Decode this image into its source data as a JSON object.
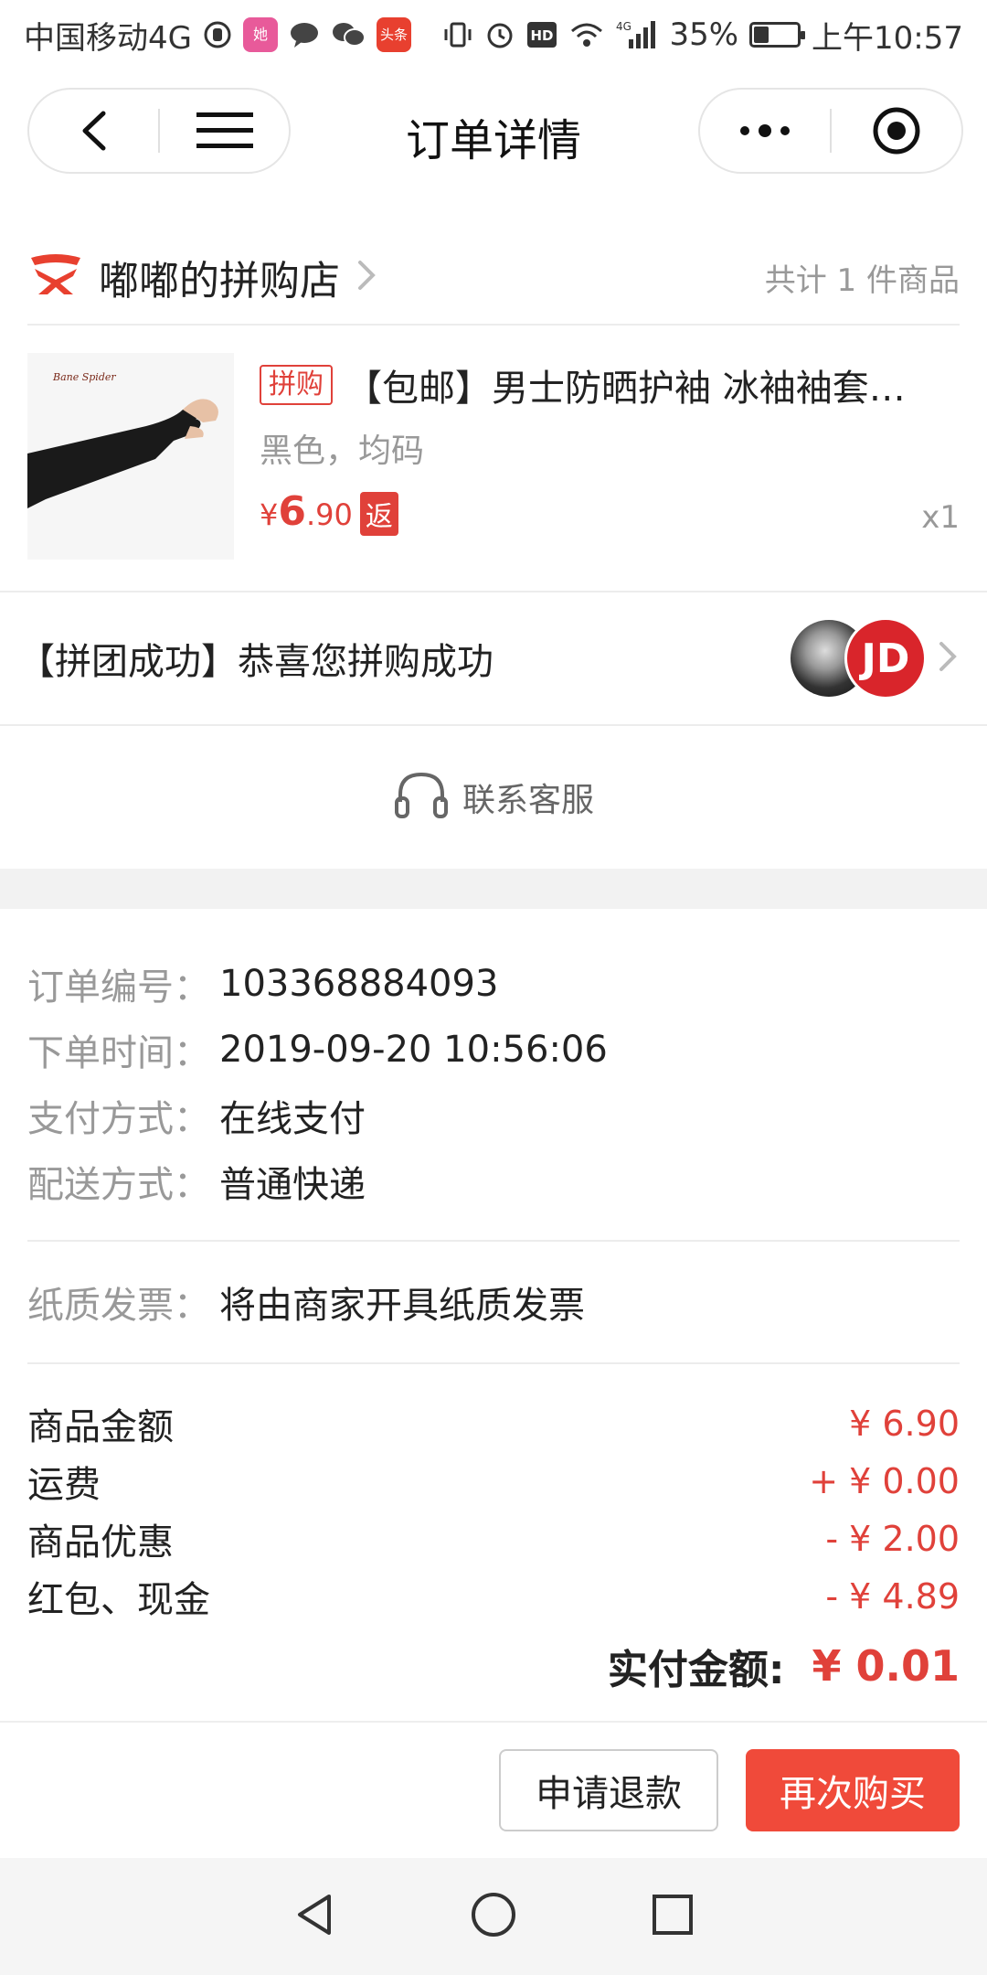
{
  "status_bar": {
    "carrier": "中国移动4G",
    "app_badge_1": "她",
    "app_badge_2": "头条",
    "network_label": "4G",
    "hd_label": "HD",
    "battery_percent": "35%",
    "battery_level": 0.35,
    "time": "上午10:57"
  },
  "nav": {
    "title": "订单详情",
    "back_icon": "chevron-left-icon",
    "home_icon": "menu-icon",
    "more_icon": "more-dots-icon",
    "close_icon": "target-close-icon"
  },
  "shop": {
    "name": "嘟嘟的拼购店",
    "count_text": "共计 1 件商品"
  },
  "product": {
    "tag": "拼购",
    "title": "【包邮】男士防晒护袖 冰袖袖套…",
    "spec": "黑色，均码",
    "price_symbol": "¥",
    "price_int": "6",
    "price_dec": ".90",
    "rebate_badge": "返",
    "qty": "x1",
    "image_brand": "Bane Spider"
  },
  "group": {
    "text": "【拼团成功】恭喜您拼购成功",
    "avatar_2_label": "JD"
  },
  "contact": {
    "label": "联系客服"
  },
  "order_info": [
    {
      "label": "订单编号：",
      "value": "103368884093"
    },
    {
      "label": "下单时间：",
      "value": "2019-09-20 10:56:06"
    },
    {
      "label": "支付方式：",
      "value": "在线支付"
    },
    {
      "label": "配送方式：",
      "value": "普通快递"
    }
  ],
  "invoice": {
    "label": "纸质发票：",
    "value": "将由商家开具纸质发票"
  },
  "summary": [
    {
      "label": "商品金额",
      "value": "¥ 6.90"
    },
    {
      "label": "运费",
      "value": "+ ¥ 0.00"
    },
    {
      "label": "商品优惠",
      "value": "- ¥ 2.00"
    },
    {
      "label": "红包、现金",
      "value": "- ¥ 4.89"
    }
  ],
  "total": {
    "label": "实付金额:",
    "value": "¥ 0.01"
  },
  "actions": {
    "refund": "申请退款",
    "rebuy": "再次购买"
  },
  "colors": {
    "accent": "#e0413a",
    "button_red": "#f04a3a",
    "muted": "#999999"
  }
}
